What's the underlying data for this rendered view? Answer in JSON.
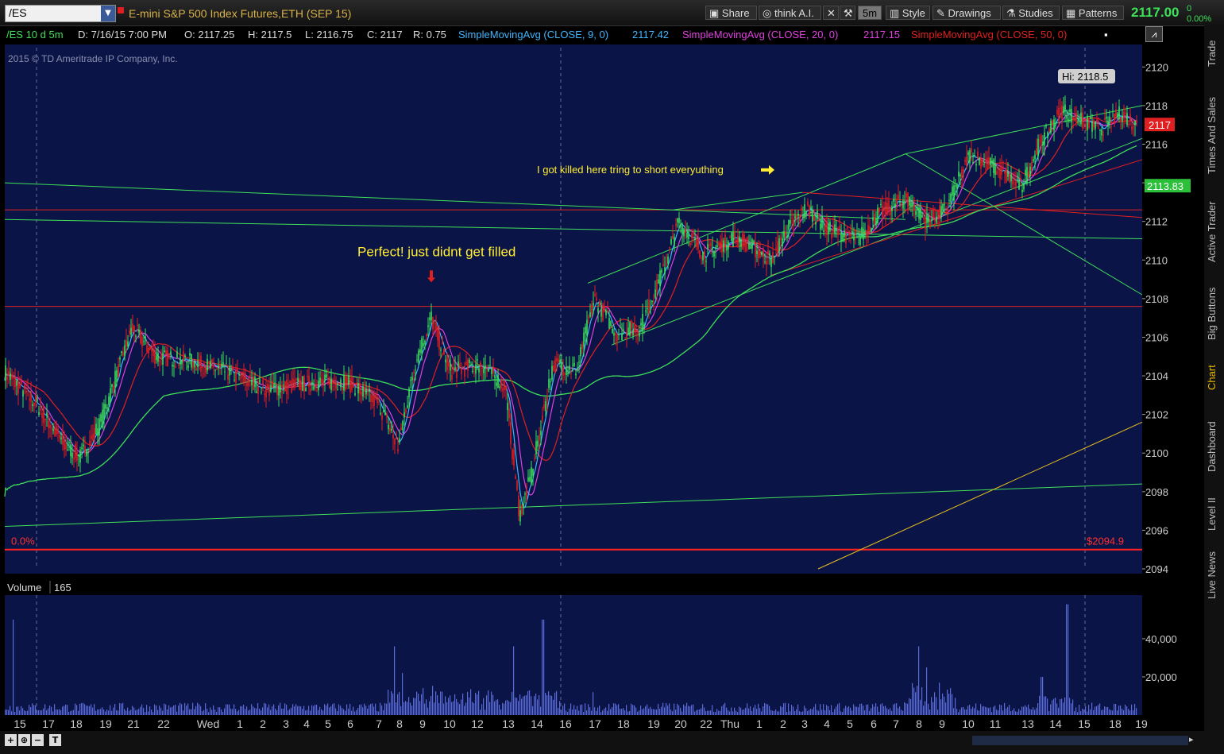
{
  "toolbar": {
    "symbol": "/ES",
    "instrument_title": "E-mini S&P 500 Index Futures,ETH (SEP 15)",
    "buttons": {
      "share": "Share",
      "think_ai": "think A.I.",
      "interval": "5m",
      "style": "Style",
      "drawings": "Drawings",
      "studies": "Studies",
      "patterns": "Patterns"
    },
    "last_price": "2117.00",
    "net_change": "0",
    "pct_change": "0.00%"
  },
  "infobar": {
    "aggregation": "/ES 10 d 5m",
    "date": "D: 7/16/15 7:00 PM",
    "open": "O: 2117.25",
    "high": "H: 2117.5",
    "low": "L: 2116.75",
    "close": "C: 2117",
    "range": "R: 0.75",
    "sma9_label": "SimpleMovingAvg (CLOSE, 9, 0)",
    "sma9_value": "2117.42",
    "sma20_label": "SimpleMovingAvg (CLOSE, 20, 0)",
    "sma20_value": "2117.15",
    "sma50_label": "SimpleMovingAvg (CLOSE, 50, 0)"
  },
  "watermark": "2015 © TD Ameritrade IP Company, Inc.",
  "side_tabs": [
    "Trade",
    "Times And Sales",
    "Active Trader",
    "Big Buttons",
    "Chart",
    "Dashboard",
    "Level II",
    "Live News"
  ],
  "colors": {
    "background": "#0b1446",
    "up": "#3ee05a",
    "down": "#e02020",
    "sma9": "#3fb6ff",
    "sma20": "#e040e0",
    "sma50": "#e02020",
    "long_ma": "#3ee05a",
    "annotation": "#ffee33"
  },
  "chart_data": [
    {
      "type": "candlestick",
      "title": "/ES 5m",
      "ylim": [
        2094,
        2121
      ],
      "y_ticks": [
        2094,
        2096,
        2098,
        2100,
        2102,
        2104,
        2106,
        2108,
        2110,
        2112,
        2114,
        2116,
        2118,
        2120
      ],
      "x_ticks": [
        "15",
        "17",
        "18",
        "19",
        "21",
        "22",
        "Wed",
        "1",
        "2",
        "3",
        "4",
        "5",
        "6",
        "7",
        "8",
        "9",
        "10",
        "12",
        "13",
        "14",
        "16",
        "17",
        "18",
        "19",
        "20",
        "22",
        "Thu",
        "1",
        "2",
        "3",
        "4",
        "5",
        "6",
        "7",
        "8",
        "9",
        "10",
        "11",
        "13",
        "14",
        "15",
        "18",
        "19"
      ],
      "price_keypoints": [
        [
          0,
          2104.2
        ],
        [
          40,
          2102.5
        ],
        [
          75,
          2100.4
        ],
        [
          95,
          2099.8
        ],
        [
          120,
          2101.5
        ],
        [
          160,
          2106.5
        ],
        [
          190,
          2105.0
        ],
        [
          230,
          2104.8
        ],
        [
          280,
          2104.2
        ],
        [
          330,
          2103.3
        ],
        [
          380,
          2103.6
        ],
        [
          430,
          2103.7
        ],
        [
          470,
          2102.6
        ],
        [
          495,
          2100.3
        ],
        [
          515,
          2104.5
        ],
        [
          537,
          2107.0
        ],
        [
          560,
          2104.2
        ],
        [
          600,
          2104.6
        ],
        [
          630,
          2103.4
        ],
        [
          648,
          2096.8
        ],
        [
          662,
          2098.7
        ],
        [
          690,
          2104.6
        ],
        [
          720,
          2104.3
        ],
        [
          742,
          2108.0
        ],
        [
          770,
          2106.2
        ],
        [
          800,
          2106.5
        ],
        [
          830,
          2109.6
        ],
        [
          848,
          2112.0
        ],
        [
          880,
          2110.3
        ],
        [
          920,
          2111.2
        ],
        [
          965,
          2110.0
        ],
        [
          985,
          2111.6
        ],
        [
          1010,
          2112.7
        ],
        [
          1035,
          2111.6
        ],
        [
          1075,
          2111.1
        ],
        [
          1100,
          2112.4
        ],
        [
          1135,
          2113.2
        ],
        [
          1160,
          2112.0
        ],
        [
          1185,
          2112.6
        ],
        [
          1215,
          2115.5
        ],
        [
          1245,
          2114.8
        ],
        [
          1280,
          2113.8
        ],
        [
          1300,
          2115.8
        ],
        [
          1330,
          2117.8
        ],
        [
          1350,
          2117.3
        ],
        [
          1380,
          2116.8
        ],
        [
          1405,
          2117.6
        ],
        [
          1425,
          2117.0
        ]
      ],
      "sma9_value": 2117.42,
      "sma20_value": 2117.15,
      "long_ma_value": 2113.83,
      "price_label": "2117",
      "long_ma_label": "2113.83",
      "high_label": "Hi: 2118.5",
      "fib_level_label": "0.0%",
      "fib_price_label": "$2094.9",
      "annotations": [
        {
          "text": "Perfect! just didnt get filled",
          "price": 2110.2,
          "x_index": 537
        },
        {
          "text": "I got killed here tring to short everyuthing",
          "price": 2114.5,
          "x_index": 680
        }
      ]
    },
    {
      "type": "bar",
      "title": "Volume",
      "label": "Volume",
      "current_value": "165",
      "y_ticks": [
        20000,
        40000
      ],
      "y_tick_labels": [
        "20,000",
        "40,000"
      ],
      "ylim": [
        0,
        62000
      ],
      "volume_spikes": [
        [
          10,
          50000
        ],
        [
          490,
          36000
        ],
        [
          500,
          22000
        ],
        [
          640,
          36000
        ],
        [
          677,
          50000
        ],
        [
          740,
          12000
        ],
        [
          1150,
          36000
        ],
        [
          1160,
          25000
        ],
        [
          1305,
          20000
        ],
        [
          1337,
          58000
        ]
      ]
    }
  ]
}
